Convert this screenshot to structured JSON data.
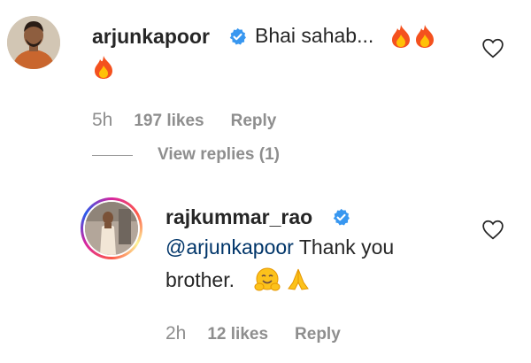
{
  "comments": [
    {
      "username": "arjunkapoor",
      "text": "Bhai sahab...",
      "time": "5h",
      "likes": "197 likes",
      "reply": "Reply"
    },
    {
      "username": "rajkummar_rao",
      "mention": "@arjunkapoor",
      "text_line1": "Thank you",
      "text_line2": "brother.",
      "time": "2h",
      "likes": "12 likes",
      "reply": "Reply"
    }
  ],
  "view_replies": "View replies (1)",
  "icons": {
    "verified": "verified-badge-icon",
    "like": "heart-outline-icon",
    "fire": "fire-emoji",
    "hug": "hugging-face-emoji",
    "pray": "folded-hands-emoji"
  },
  "colors": {
    "verified": "#3897f0",
    "muted": "#8e8e8e",
    "mention": "#003569"
  }
}
